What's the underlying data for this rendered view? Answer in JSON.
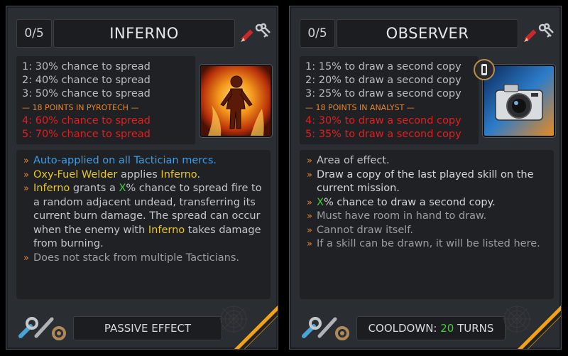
{
  "cards": [
    {
      "points": "0/5",
      "title": "INFERNO",
      "levels": [
        "1: 30% chance to spread",
        "2: 40% chance to spread",
        "3: 50% chance to spread"
      ],
      "separator": "— 18 POINTS IN PYROTECH —",
      "bonus_levels": [
        "4: 60% chance to spread",
        "5: 70% chance to spread"
      ],
      "description": {
        "l1": "Auto-applied on all Tactician mercs.",
        "l2_a": "Oxy-Fuel Welder",
        "l2_b": " applies ",
        "l2_c": "Inferno",
        "l2_d": ".",
        "l3_a": "Inferno",
        "l3_b": " grants a ",
        "l3_c": "X",
        "l3_d": "% chance to spread fire to a random adjacent undead, transferring its current burn damage. The spread can occur when the enemy with ",
        "l3_e": "Inferno",
        "l3_f": " takes damage from burning.",
        "l4": "Does not stack from multiple Tacticians."
      },
      "footer": "PASSIVE EFFECT"
    },
    {
      "points": "0/5",
      "title": "OBSERVER",
      "levels": [
        "1: 15% to draw a second copy",
        "2: 20% to draw a second copy",
        "3: 25% to draw a second copy"
      ],
      "separator": "— 18 POINTS IN ANALYST —",
      "bonus_levels": [
        "4: 30% to draw a second copy",
        "5: 35% to draw a second copy"
      ],
      "description": {
        "l1": "Area of effect.",
        "l2": "Draw a copy of the last played skill on the current mission.",
        "l3_a": "X",
        "l3_b": "% chance to draw a second copy.",
        "l4": "Must have room in hand to draw.",
        "l5": "Cannot draw itself.",
        "l6": "If a skill can be drawn, it will be listed here."
      },
      "footer_label": "COOLDOWN: ",
      "footer_value": "20",
      "footer_suffix": " TURNS"
    }
  ],
  "colors": {
    "highlight_orange": "#e8862a",
    "bonus_red": "#e21f1f",
    "keyword_yellow": "#e7c728",
    "keyword_blue": "#3f9ee8",
    "keyword_green": "#3fd13a"
  },
  "icons": [
    "edit-pencil-icon",
    "keys-icon",
    "wrench-tools-icon",
    "flame-figure-portrait",
    "camera-portrait",
    "analyst-badge-icon"
  ]
}
